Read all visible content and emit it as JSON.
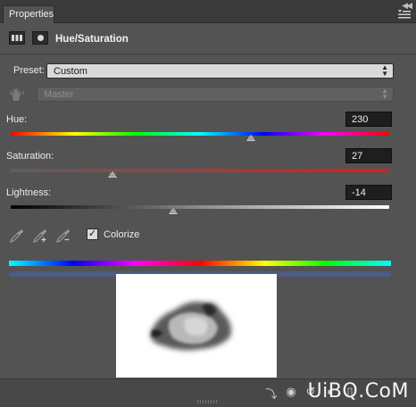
{
  "tab": {
    "label": "Properties"
  },
  "panel": {
    "title": "Hue/Saturation"
  },
  "preset": {
    "label": "Preset:",
    "value": "Custom"
  },
  "channel": {
    "value": "Master"
  },
  "hue": {
    "label": "Hue:",
    "value": "230",
    "position": 0.635
  },
  "saturation": {
    "label": "Saturation:",
    "value": "27",
    "position": 0.27
  },
  "lightness": {
    "label": "Lightness:",
    "value": "-14",
    "position": 0.43
  },
  "colorize": {
    "label": "Colorize",
    "checked": true,
    "check_glyph": "✓"
  },
  "footer": {
    "watermark": "UiBQ.CoM"
  },
  "icons": {
    "collapse": "collapse-icon",
    "panel_menu": "panel-menu-icon",
    "adjustment": "adjustment-layer-icon",
    "mask": "mask-icon",
    "hand": "on-image-adjust-hand-icon",
    "eyedroppers": [
      "eyedropper-icon",
      "eyedropper-plus-icon",
      "eyedropper-minus-icon"
    ]
  },
  "colors": {
    "panel_bg": "#535353",
    "tab_bar": "#3a3a3a",
    "footer_bg": "#484848"
  }
}
